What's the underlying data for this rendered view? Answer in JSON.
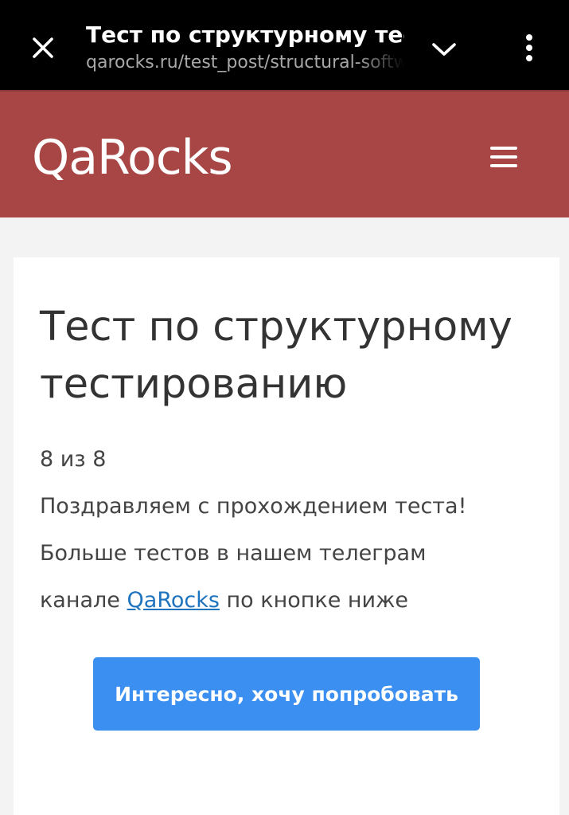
{
  "browser": {
    "title": "Тест по структурному тестированию",
    "url": "qarocks.ru/test_post/structural-software-testing/",
    "icons": {
      "close": "close-icon",
      "expand": "chevron-down-icon",
      "menu": "more-vert-icon"
    }
  },
  "site": {
    "logo": "QaRocks",
    "brand_color": "#a84646",
    "menu_icon": "hamburger-icon"
  },
  "content": {
    "heading": "Тест по структурному тестированию",
    "score": "8 из 8",
    "congrats": "Поздравляем с прохождением теста!",
    "more_line1": "Больше тестов в нашем телеграм",
    "more_line2_prefix": "канале ",
    "telegram_link": "QaRocks",
    "more_line2_suffix": " по кнопке ниже",
    "cta_label": "Интересно, хочу попробовать",
    "cta_color": "#3b8ff0"
  }
}
